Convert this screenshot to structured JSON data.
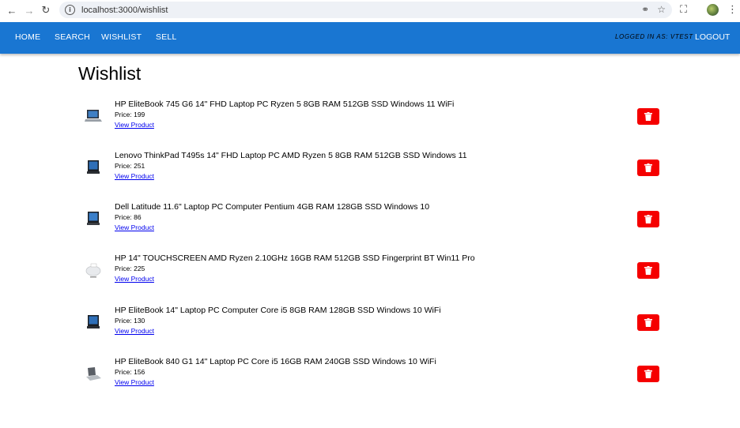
{
  "browser": {
    "url": "localhost:3000/wishlist",
    "back_icon": "back-arrow-icon",
    "forward_icon": "forward-arrow-icon",
    "reload_icon": "reload-icon"
  },
  "navbar": {
    "color": "#1976d2",
    "links": [
      "HOME",
      "SEARCH",
      "WISHLIST",
      "SELL"
    ],
    "logged_in_label": "LOGGED IN AS: VTEST",
    "logout_label": "LOGOUT"
  },
  "page": {
    "title": "Wishlist"
  },
  "wishlist": {
    "delete_color": "#f50000",
    "items": [
      {
        "title": "HP EliteBook 745 G6 14\" FHD Laptop PC Ryzen 5 8GB RAM 512GB SSD Windows 11 WiFi",
        "price": "Price: 199",
        "link": "View Product",
        "thumb": "laptop-open"
      },
      {
        "title": "Lenovo ThinkPad T495s 14\" FHD Laptop PC AMD Ryzen 5 8GB RAM 512GB SSD Windows 11",
        "price": "Price: 251",
        "link": "View Product",
        "thumb": "laptop-front"
      },
      {
        "title": "Dell Latitude 11.6\" Laptop PC Computer Pentium 4GB RAM 128GB SSD Windows 10",
        "price": "Price: 86",
        "link": "View Product",
        "thumb": "laptop-front"
      },
      {
        "title": "HP 14\" TOUCHSCREEN AMD Ryzen 2.10GHz 16GB RAM 512GB SSD Fingerprint BT Win11 Pro",
        "price": "Price: 225",
        "link": "View Product",
        "thumb": "laptop-closed"
      },
      {
        "title": "HP EliteBook 14\" Laptop PC Computer Core i5 8GB RAM 128GB SSD Windows 10 WiFi",
        "price": "Price: 130",
        "link": "View Product",
        "thumb": "laptop-front"
      },
      {
        "title": "HP EliteBook 840 G1 14\" Laptop PC Core i5 16GB RAM 240GB SSD Windows 10 WiFi",
        "price": "Price: 156",
        "link": "View Product",
        "thumb": "laptop-flat"
      }
    ]
  }
}
